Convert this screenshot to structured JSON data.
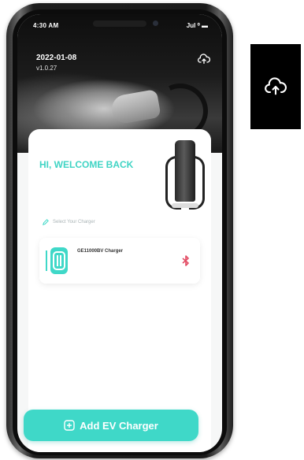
{
  "status_bar": {
    "time": "4:30 AM",
    "icons": "Jul ⁰ ▬"
  },
  "header": {
    "date": "2022-01-08",
    "version": "v1.0.27"
  },
  "welcome": {
    "title": "HI, WELCOME BACK"
  },
  "charger_select": {
    "label": "Select Your Charger"
  },
  "chargers": [
    {
      "name": "GE11000BV Charger"
    }
  ],
  "actions": {
    "add_charger_label": "Add EV Charger"
  },
  "colors": {
    "accent": "#3fd8c8",
    "bluetooth": "#e24b63"
  },
  "icons": {
    "cloud": "cloud-upload-icon",
    "bluetooth": "bluetooth-icon",
    "plus": "plus-circle-icon",
    "pencil": "edit-icon",
    "charger": "ev-charger-icon"
  }
}
